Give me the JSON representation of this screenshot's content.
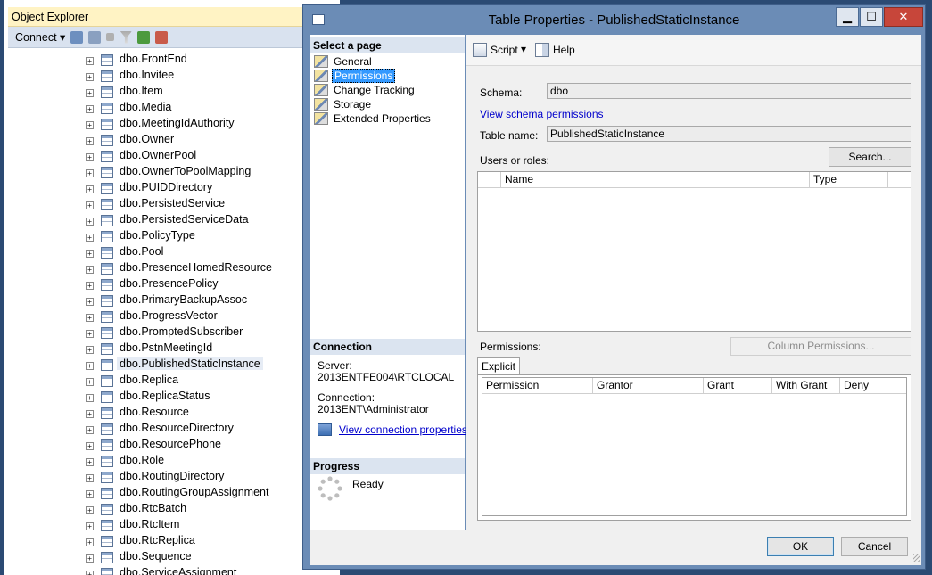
{
  "object_explorer": {
    "title": "Object Explorer",
    "connect_label": "Connect",
    "tree_items": [
      "dbo.FrontEnd",
      "dbo.Invitee",
      "dbo.Item",
      "dbo.Media",
      "dbo.MeetingIdAuthority",
      "dbo.Owner",
      "dbo.OwnerPool",
      "dbo.OwnerToPoolMapping",
      "dbo.PUIDDirectory",
      "dbo.PersistedService",
      "dbo.PersistedServiceData",
      "dbo.PolicyType",
      "dbo.Pool",
      "dbo.PresenceHomedResource",
      "dbo.PresencePolicy",
      "dbo.PrimaryBackupAssoc",
      "dbo.ProgressVector",
      "dbo.PromptedSubscriber",
      "dbo.PstnMeetingId",
      "dbo.PublishedStaticInstance",
      "dbo.Replica",
      "dbo.ReplicaStatus",
      "dbo.Resource",
      "dbo.ResourceDirectory",
      "dbo.ResourcePhone",
      "dbo.Role",
      "dbo.RoutingDirectory",
      "dbo.RoutingGroupAssignment",
      "dbo.RtcBatch",
      "dbo.RtcItem",
      "dbo.RtcReplica",
      "dbo.Sequence",
      "dbo.ServiceAssignment"
    ],
    "selected_item": "dbo.PublishedStaticInstance"
  },
  "dialog": {
    "title": "Table Properties - PublishedStaticInstance",
    "window_buttons": {
      "minimize": "▁",
      "maximize": "☐",
      "close": "✕"
    },
    "select_page": {
      "heading": "Select a page",
      "items": [
        "General",
        "Permissions",
        "Change Tracking",
        "Storage",
        "Extended Properties"
      ],
      "active": "Permissions"
    },
    "connection": {
      "heading": "Connection",
      "server_label": "Server:",
      "server_value": "2013ENTFE004\\RTCLOCAL",
      "connection_label": "Connection:",
      "connection_value": "2013ENT\\Administrator",
      "view_link": "View connection properties"
    },
    "progress": {
      "heading": "Progress",
      "status": "Ready"
    },
    "toolbar": {
      "script_label": "Script",
      "help_label": "Help"
    },
    "permissions_page": {
      "schema_label": "Schema:",
      "schema_value": "dbo",
      "view_schema_link": "View schema permissions",
      "table_name_label": "Table name:",
      "table_name_value": "PublishedStaticInstance",
      "users_roles_label": "Users or roles:",
      "search_button": "Search...",
      "users_columns": [
        "Name",
        "Type"
      ],
      "permissions_label": "Permissions:",
      "column_permissions_button": "Column Permissions...",
      "tab_label": "Explicit",
      "perm_columns": [
        "Permission",
        "Grantor",
        "Grant",
        "With Grant",
        "Deny"
      ]
    },
    "ok_button": "OK",
    "cancel_button": "Cancel"
  },
  "colors": {
    "selected_page_bg": "#3399ff",
    "link": "#0000cc",
    "close_button": "#c7463a"
  }
}
